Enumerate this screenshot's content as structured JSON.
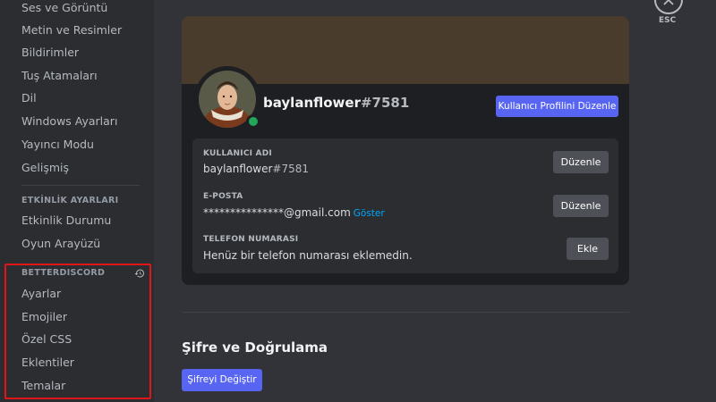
{
  "sidebar": {
    "items_top": [
      {
        "label": "Ses ve Görüntü"
      },
      {
        "label": "Metin ve Resimler"
      },
      {
        "label": "Bildirimler"
      },
      {
        "label": "Tuş Atamaları"
      },
      {
        "label": "Dil"
      },
      {
        "label": "Windows Ayarları"
      },
      {
        "label": "Yayıncı Modu"
      },
      {
        "label": "Gelişmiş"
      }
    ],
    "activity_header": "ETKİNLİK AYARLARI",
    "activity_items": [
      {
        "label": "Etkinlik Durumu"
      },
      {
        "label": "Oyun Arayüzü"
      }
    ],
    "bd_header": "BETTERDISCORD",
    "bd_items": [
      {
        "label": "Ayarlar"
      },
      {
        "label": "Emojiler"
      },
      {
        "label": "Özel CSS"
      },
      {
        "label": "Eklentiler"
      },
      {
        "label": "Temalar"
      }
    ],
    "bd_highlight_color": "#e0161b"
  },
  "close": {
    "label": "ESC",
    "icon": "close-icon"
  },
  "profile": {
    "banner_color": "#4a3c2c",
    "username": "baylanflower",
    "discriminator": "#7581",
    "status": "online",
    "status_color": "#23a55a",
    "edit_profile_label": "Kullanıcı Profilini Düzenle"
  },
  "fields": {
    "username": {
      "label": "KULLANICI ADI",
      "value": "baylanflower",
      "discriminator": "#7581",
      "button": "Düzenle"
    },
    "email": {
      "label": "E-POSTA",
      "value": "***************@gmail.com",
      "reveal": "Göster",
      "button": "Düzenle"
    },
    "phone": {
      "label": "TELEFON NUMARASI",
      "value": "Henüz bir telefon numarası eklemedin.",
      "button": "Ekle"
    }
  },
  "security": {
    "title": "Şifre ve Doğrulama",
    "change_password_label": "Şifreyi Değiştir"
  },
  "colors": {
    "accent": "#5865f2",
    "link": "#00a8fc"
  }
}
